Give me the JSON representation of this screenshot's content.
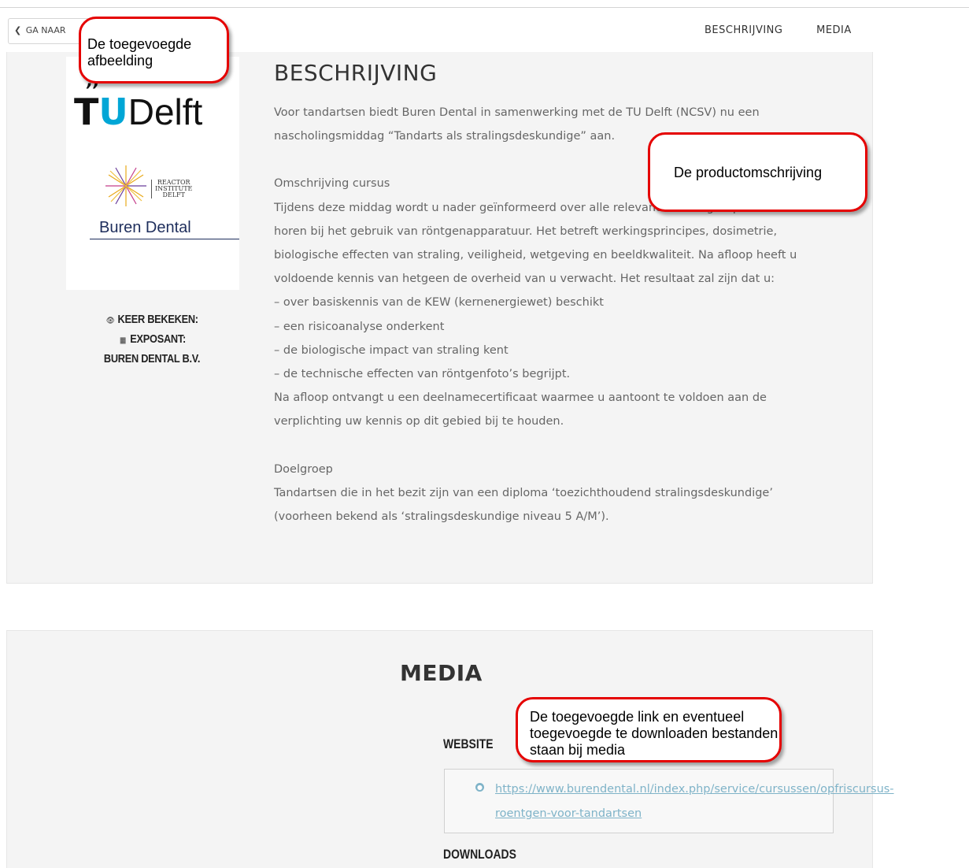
{
  "nav": {
    "back_label": "GA NAAR OVERZICHT",
    "back_visible": "GA NAAR",
    "items": [
      "BESCHRIJVING",
      "MEDIA"
    ]
  },
  "logos": {
    "tu_t": "T",
    "tu_u": "U",
    "tu_delft": "Delft",
    "reactor_line1": "REACTOR",
    "reactor_line2": "INSTITUTE",
    "reactor_line3": "DELFT",
    "buren": "Buren Dental"
  },
  "meta": {
    "views_label": "KEER BEKEKEN:",
    "exhibitor_label": "EXPOSANT:",
    "exhibitor_value": "BUREN DENTAL B.V."
  },
  "description": {
    "title": "BESCHRIJVING",
    "lines": [
      "Voor tandartsen biedt Buren Dental in samenwerking met de TU Delft (NCSV) nu een",
      "nascholingsmiddag “Tandarts als stralingsdeskundige” aan.",
      "",
      "Omschrijving cursus",
      "Tijdens deze middag wordt u nader geïnformeerd over alle relevante stralingsaspecten die",
      "horen bij het gebruik van röntgenapparatuur. Het betreft werkingsprincipes, dosimetrie,",
      "biologische effecten van straling, veiligheid, wetgeving en beeldkwaliteit. Na afloop heeft u",
      "voldoende kennis van hetgeen de overheid van u verwacht. Het resultaat zal zijn dat u:",
      "– over basiskennis van de KEW (kernenergiewet) beschikt",
      "– een risicoanalyse onderkent",
      "– de biologische impact van straling kent",
      "– de technische effecten van röntgenfoto’s begrijpt.",
      "Na afloop ontvangt u een deelnamecertificaat waarmee u aantoont te voldoen aan de",
      "verplichting uw kennis op dit gebied bij te houden.",
      "",
      "Doelgroep",
      "Tandartsen die in het bezit zijn van een diploma ‘toezichthoudend stralingsdeskundige’",
      "(voorheen bekend als ‘stralingsdeskundige niveau 5 A/M’)."
    ]
  },
  "media": {
    "title": "MEDIA",
    "website_label": "WEBSITE",
    "website_url_line1": "https://www.burendental.nl/index.php/service/cursussen/opfriscursus-",
    "website_url_line2": "roentgen-voor-tandartsen",
    "downloads_label": "DOWNLOADS"
  },
  "callouts": {
    "image": "De toegevoegde afbeelding",
    "description": "De productomschrijving",
    "media": "De toegevoegde link en eventueel toegevoegde te downloaden bestanden staan bij media"
  },
  "colors": {
    "accent_tu": "#00a6d6",
    "link": "#7fb3c8",
    "callout_border": "#e50000",
    "buren_navy": "#1e2e5c"
  }
}
